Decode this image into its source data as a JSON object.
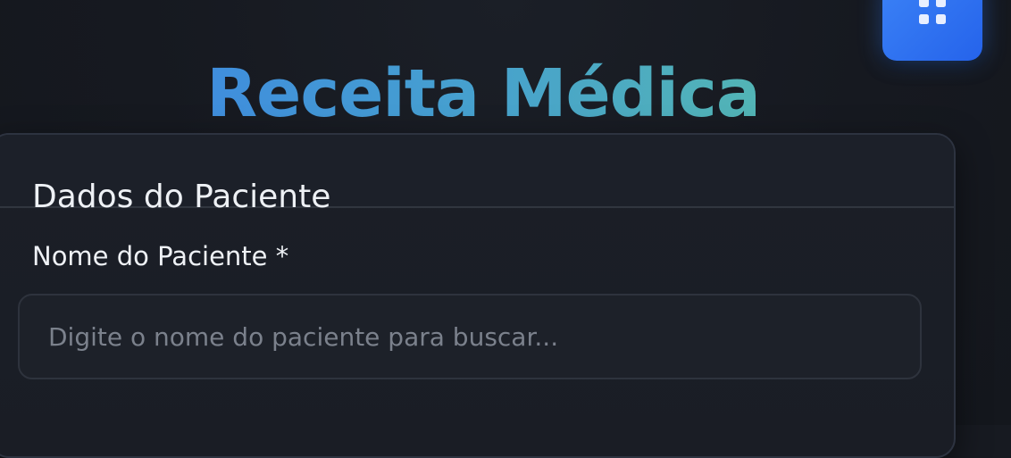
{
  "header": {
    "title": "Receita Médica",
    "apps_button": {
      "icon": "grid-icon",
      "accent": "#3b82f6"
    }
  },
  "patient_card": {
    "title": "Dados do Paciente",
    "name_field": {
      "label": "Nome do Paciente *",
      "value": "",
      "placeholder": "Digite o nome do paciente para buscar..."
    }
  },
  "colors": {
    "background": "#171a21",
    "title_gradient_start": "#3a7fe8",
    "title_gradient_end": "#5bc3a3",
    "card_border": "#2d3340",
    "placeholder": "#7b818c"
  }
}
